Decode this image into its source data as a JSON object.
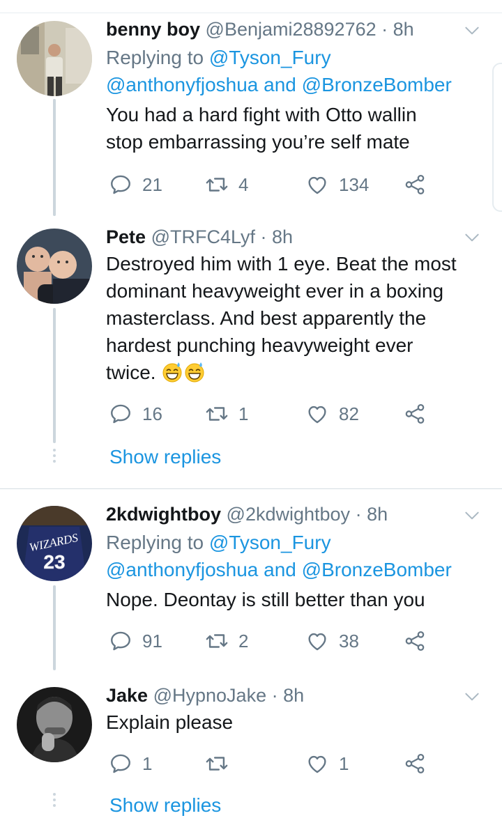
{
  "tweets": [
    {
      "name": "benny boy",
      "handle": "@Benjami28892762",
      "time": "8h",
      "replying_label": "Replying to",
      "reply_line1_mention": "@Tyson_Fury",
      "reply_line2_mention1": "@anthonyfjoshua",
      "reply_line2_and": "and",
      "reply_line2_mention2": "@BronzeBomber",
      "text_line1": "You had a hard fight with Otto wallin",
      "text_line2": "stop embarrassing you’re self mate",
      "replies": "21",
      "retweets": "4",
      "likes": "134"
    },
    {
      "name": "Pete",
      "handle": "@TRFC4Lyf",
      "time": "8h",
      "text_line1": "Destroyed him with 1 eye. Beat the most",
      "text_line2": "dominant heavyweight ever in a boxing",
      "text_line3": "masterclass. And best apparently the",
      "text_line4": "hardest punching heavyweight ever",
      "text_line5": "twice.",
      "replies": "16",
      "retweets": "1",
      "likes": "82",
      "show_replies": "Show replies"
    },
    {
      "name": "2kdwightboy",
      "handle": "@2kdwightboy",
      "time": "8h",
      "replying_label": "Replying to",
      "reply_line1_mention": "@Tyson_Fury",
      "reply_line2_mention1": "@anthonyfjoshua",
      "reply_line2_and": "and",
      "reply_line2_mention2": "@BronzeBomber",
      "text_line1": "Nope. Deontay is still better than you",
      "replies": "91",
      "retweets": "2",
      "likes": "38",
      "jersey_text": "WIZARDS",
      "jersey_number": "23"
    },
    {
      "name": "Jake",
      "handle": "@HypnoJake",
      "time": "8h",
      "text_line1": "Explain please",
      "replies": "1",
      "retweets": "",
      "likes": "1",
      "show_replies": "Show replies"
    }
  ],
  "separator_dot": "·",
  "icons": [
    "reply-icon",
    "retweet-icon",
    "like-icon",
    "share-icon",
    "chevron-down-icon"
  ],
  "colors": {
    "link": "#1b95e0",
    "muted": "#657786",
    "text": "#14171a",
    "thread": "#ccd6dd"
  }
}
